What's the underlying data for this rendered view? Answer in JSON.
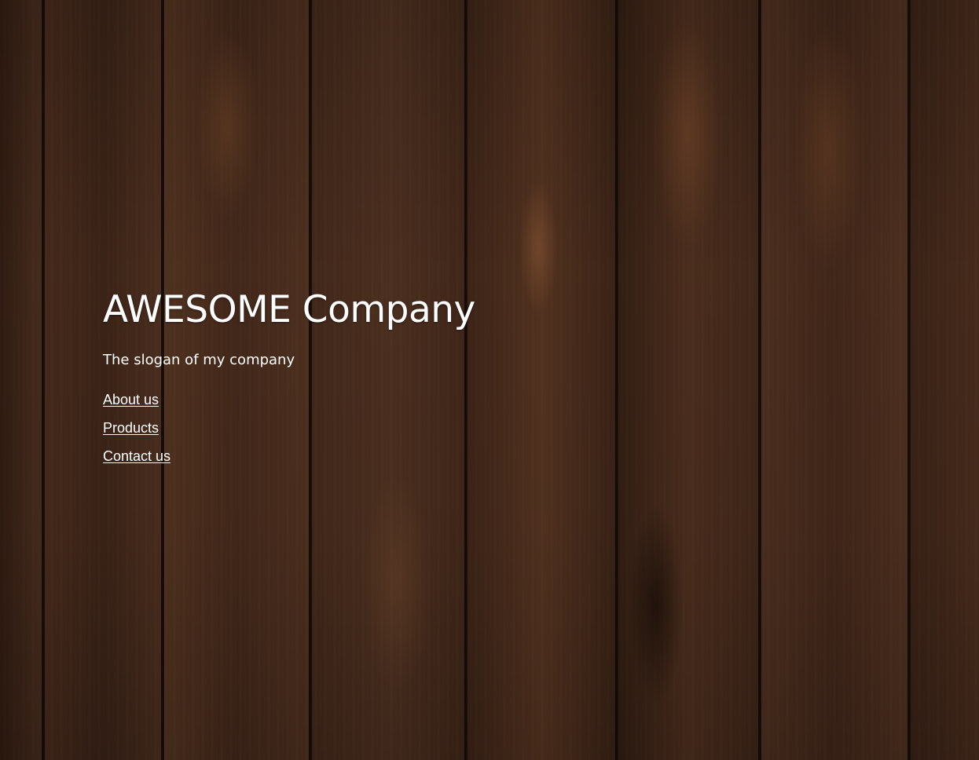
{
  "brand": {
    "title": "AWESOME Company",
    "slogan": "The slogan of my company"
  },
  "nav": {
    "items": [
      {
        "label": "About us"
      },
      {
        "label": "Products"
      },
      {
        "label": "Contact us"
      }
    ]
  },
  "background": {
    "description_icon": "wood-plank-texture",
    "base_color": "#4a2e1f",
    "text_color": "#ffffff"
  }
}
